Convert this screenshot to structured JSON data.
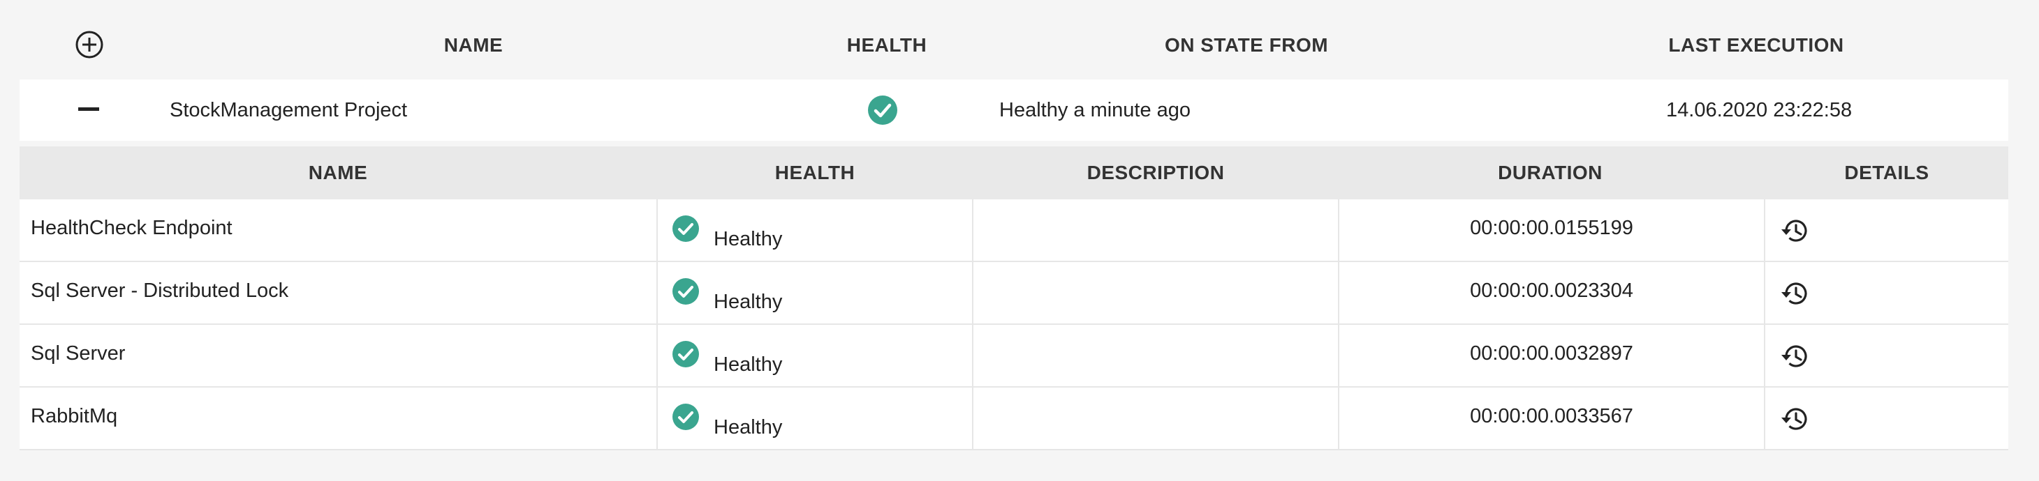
{
  "header": {
    "add_icon": "plus-circle-icon",
    "columns": [
      "NAME",
      "HEALTH",
      "ON STATE FROM",
      "LAST EXECUTION"
    ]
  },
  "project": {
    "collapse_icon": "minus-icon",
    "name": "StockManagement Project",
    "health_icon": "check-circle-icon",
    "on_state_from": "Healthy a minute ago",
    "last_execution": "14.06.2020 23:22:58"
  },
  "checks_table": {
    "columns": [
      "NAME",
      "HEALTH",
      "DESCRIPTION",
      "DURATION",
      "DETAILS"
    ],
    "rows": [
      {
        "name": "HealthCheck Endpoint",
        "health": "Healthy",
        "description": "",
        "duration": "00:00:00.0155199",
        "details_icon": "history-icon"
      },
      {
        "name": "Sql Server - Distributed Lock",
        "health": "Healthy",
        "description": "",
        "duration": "00:00:00.0023304",
        "details_icon": "history-icon"
      },
      {
        "name": "Sql Server",
        "health": "Healthy",
        "description": "",
        "duration": "00:00:00.0032897",
        "details_icon": "history-icon"
      },
      {
        "name": "RabbitMq",
        "health": "Healthy",
        "description": "",
        "duration": "00:00:00.0033567",
        "details_icon": "history-icon"
      }
    ]
  },
  "colors": {
    "healthy": "#3aa58f",
    "background": "#f5f5f5",
    "header_band": "#e9e9e9"
  }
}
